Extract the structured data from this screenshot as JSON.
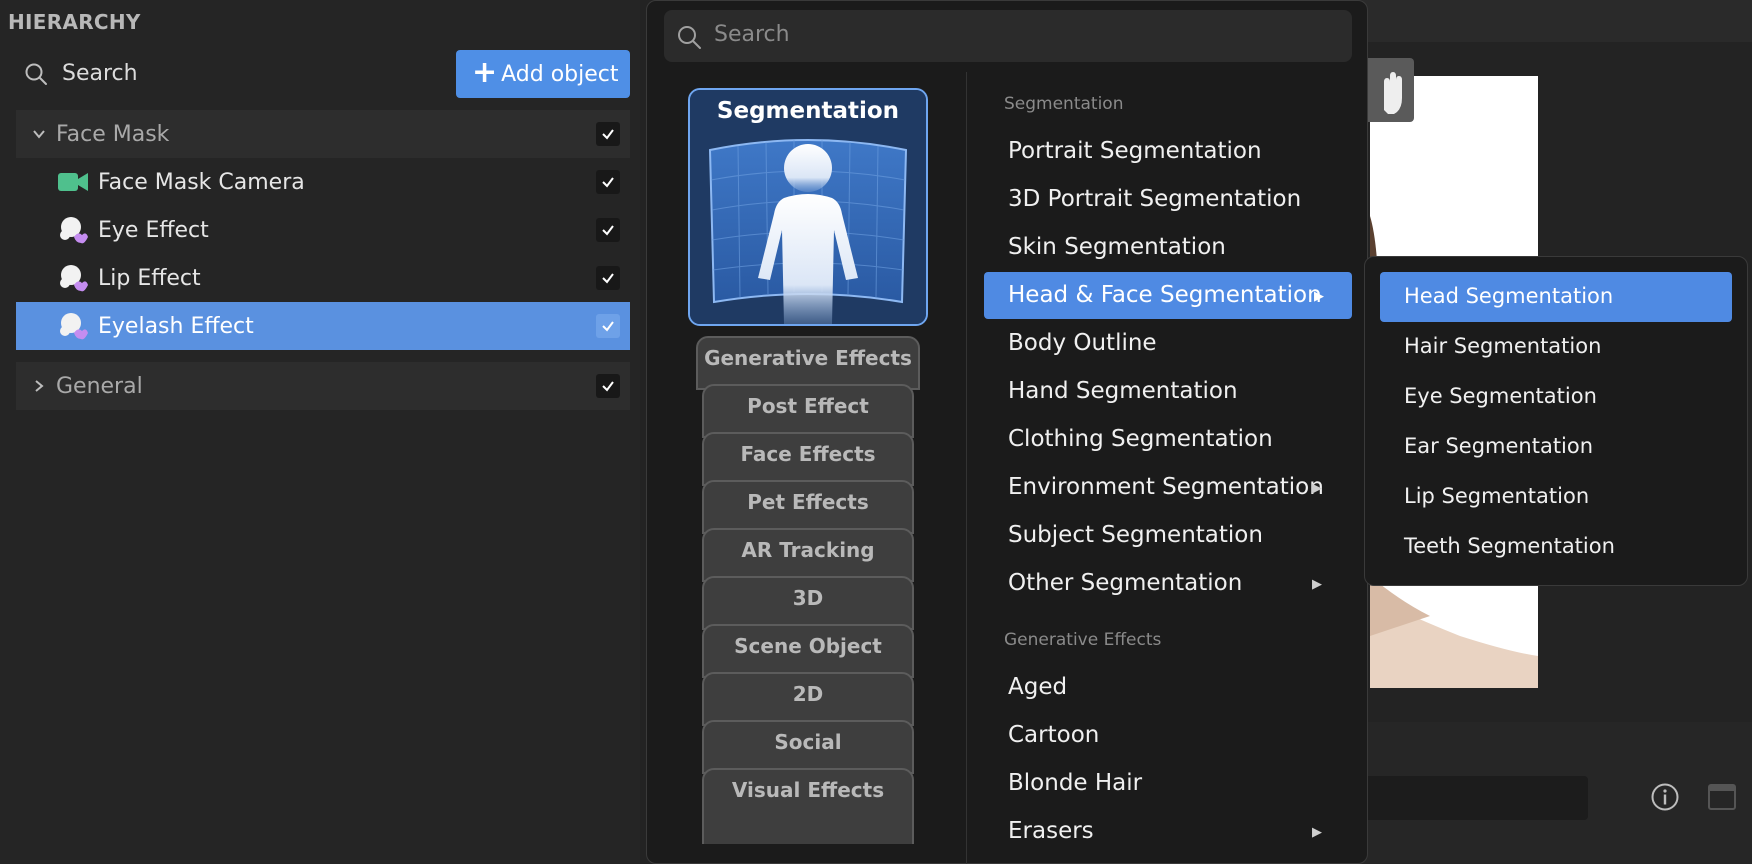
{
  "hierarchy": {
    "title": "HIERARCHY",
    "search_label": "Search",
    "add_button_label": "Add object",
    "rows": [
      {
        "label": "Face Mask",
        "kind": "group-open",
        "checked": true
      },
      {
        "label": "Face Mask Camera",
        "kind": "camera",
        "checked": true
      },
      {
        "label": "Eye Effect",
        "kind": "effect",
        "checked": true
      },
      {
        "label": "Lip Effect",
        "kind": "effect",
        "checked": true
      },
      {
        "label": "Eyelash Effect",
        "kind": "effect",
        "checked": true,
        "selected": true
      },
      {
        "label": "General",
        "kind": "group-closed",
        "checked": true
      }
    ]
  },
  "popup": {
    "search_placeholder": "Search",
    "category_card_title": "Segmentation",
    "category_tabs": [
      "Generative Effects",
      "Post Effect",
      "Face Effects",
      "Pet Effects",
      "AR Tracking",
      "3D",
      "Scene Object",
      "2D",
      "Social",
      "Visual Effects"
    ],
    "sections": [
      {
        "heading": "Segmentation",
        "items": [
          {
            "label": "Portrait Segmentation",
            "has_submenu": false
          },
          {
            "label": "3D Portrait Segmentation",
            "has_submenu": false
          },
          {
            "label": "Skin Segmentation",
            "has_submenu": false
          },
          {
            "label": "Head & Face Segmentation",
            "has_submenu": true,
            "highlighted": true
          },
          {
            "label": "Body Outline",
            "has_submenu": false
          },
          {
            "label": "Hand Segmentation",
            "has_submenu": false
          },
          {
            "label": "Clothing Segmentation",
            "has_submenu": false
          },
          {
            "label": "Environment Segmentation",
            "has_submenu": true
          },
          {
            "label": "Subject Segmentation",
            "has_submenu": false
          },
          {
            "label": "Other Segmentation",
            "has_submenu": true
          }
        ]
      },
      {
        "heading": "Generative Effects",
        "items": [
          {
            "label": "Aged",
            "has_submenu": false
          },
          {
            "label": "Cartoon",
            "has_submenu": false
          },
          {
            "label": "Blonde Hair",
            "has_submenu": false
          },
          {
            "label": "Erasers",
            "has_submenu": true
          }
        ]
      }
    ]
  },
  "submenu": {
    "items": [
      "Head Segmentation",
      "Hair Segmentation",
      "Eye Segmentation",
      "Ear Segmentation",
      "Lip Segmentation",
      "Teeth Segmentation"
    ],
    "highlighted_index": 0
  },
  "colors": {
    "accent": "#4f8ae3",
    "camera_icon": "#4fc08d",
    "effect_icon": "#c58df0"
  },
  "icons": {
    "search": "search-icon",
    "add": "plus-icon",
    "camera": "camera-icon",
    "effect": "face-effect-icon",
    "check": "check-icon",
    "expand": "chevron-down-icon",
    "collapse": "chevron-right-icon",
    "submenu": "triangle-right-icon",
    "info": "info-icon",
    "hand": "hand-icon"
  }
}
